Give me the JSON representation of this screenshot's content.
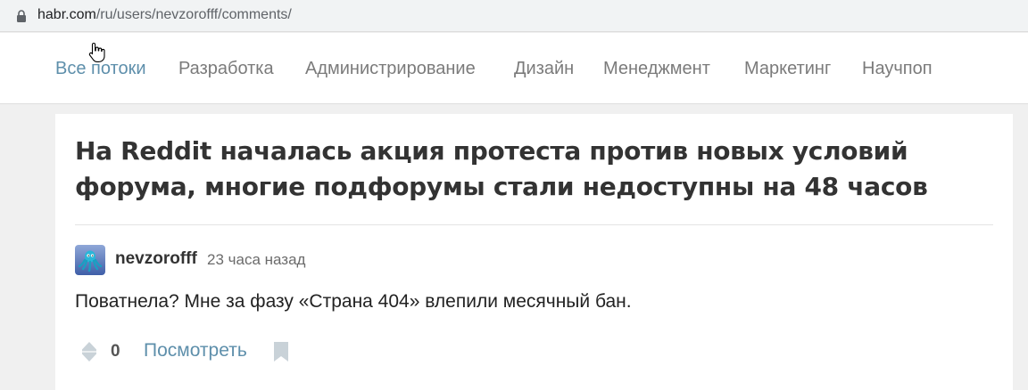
{
  "browser": {
    "url_host": "habr.com",
    "url_path": "/ru/users/nevzorofff/comments/",
    "lock_icon": "lock-icon"
  },
  "nav": {
    "items": [
      {
        "label": "Все потоки",
        "active": true
      },
      {
        "label": "Разработка",
        "active": false
      },
      {
        "label": "Администрирование",
        "active": false
      },
      {
        "label": "Дизайн",
        "active": false
      },
      {
        "label": "Менеджмент",
        "active": false
      },
      {
        "label": "Маркетинг",
        "active": false
      },
      {
        "label": "Научпоп",
        "active": false
      }
    ]
  },
  "post": {
    "title": "На Reddit началась акция протеста против новых условий форума, многие подфорумы стали недоступны на 48 часов"
  },
  "comment": {
    "author": "nevzorofff",
    "time": "23 часа назад",
    "text": "Поватнела? Мне за фазу «Страна 404» влепили месячный бан.",
    "votes": "0",
    "view_label": "Посмотреть"
  },
  "colors": {
    "accent": "#5e8fab",
    "nav_text": "#7b7b7b",
    "title_text": "#333333",
    "background": "#f0f0f0"
  },
  "icons": [
    "lock-icon",
    "hand-cursor-icon",
    "avatar-octopus-icon",
    "vote-diamond-icon",
    "bookmark-icon"
  ]
}
